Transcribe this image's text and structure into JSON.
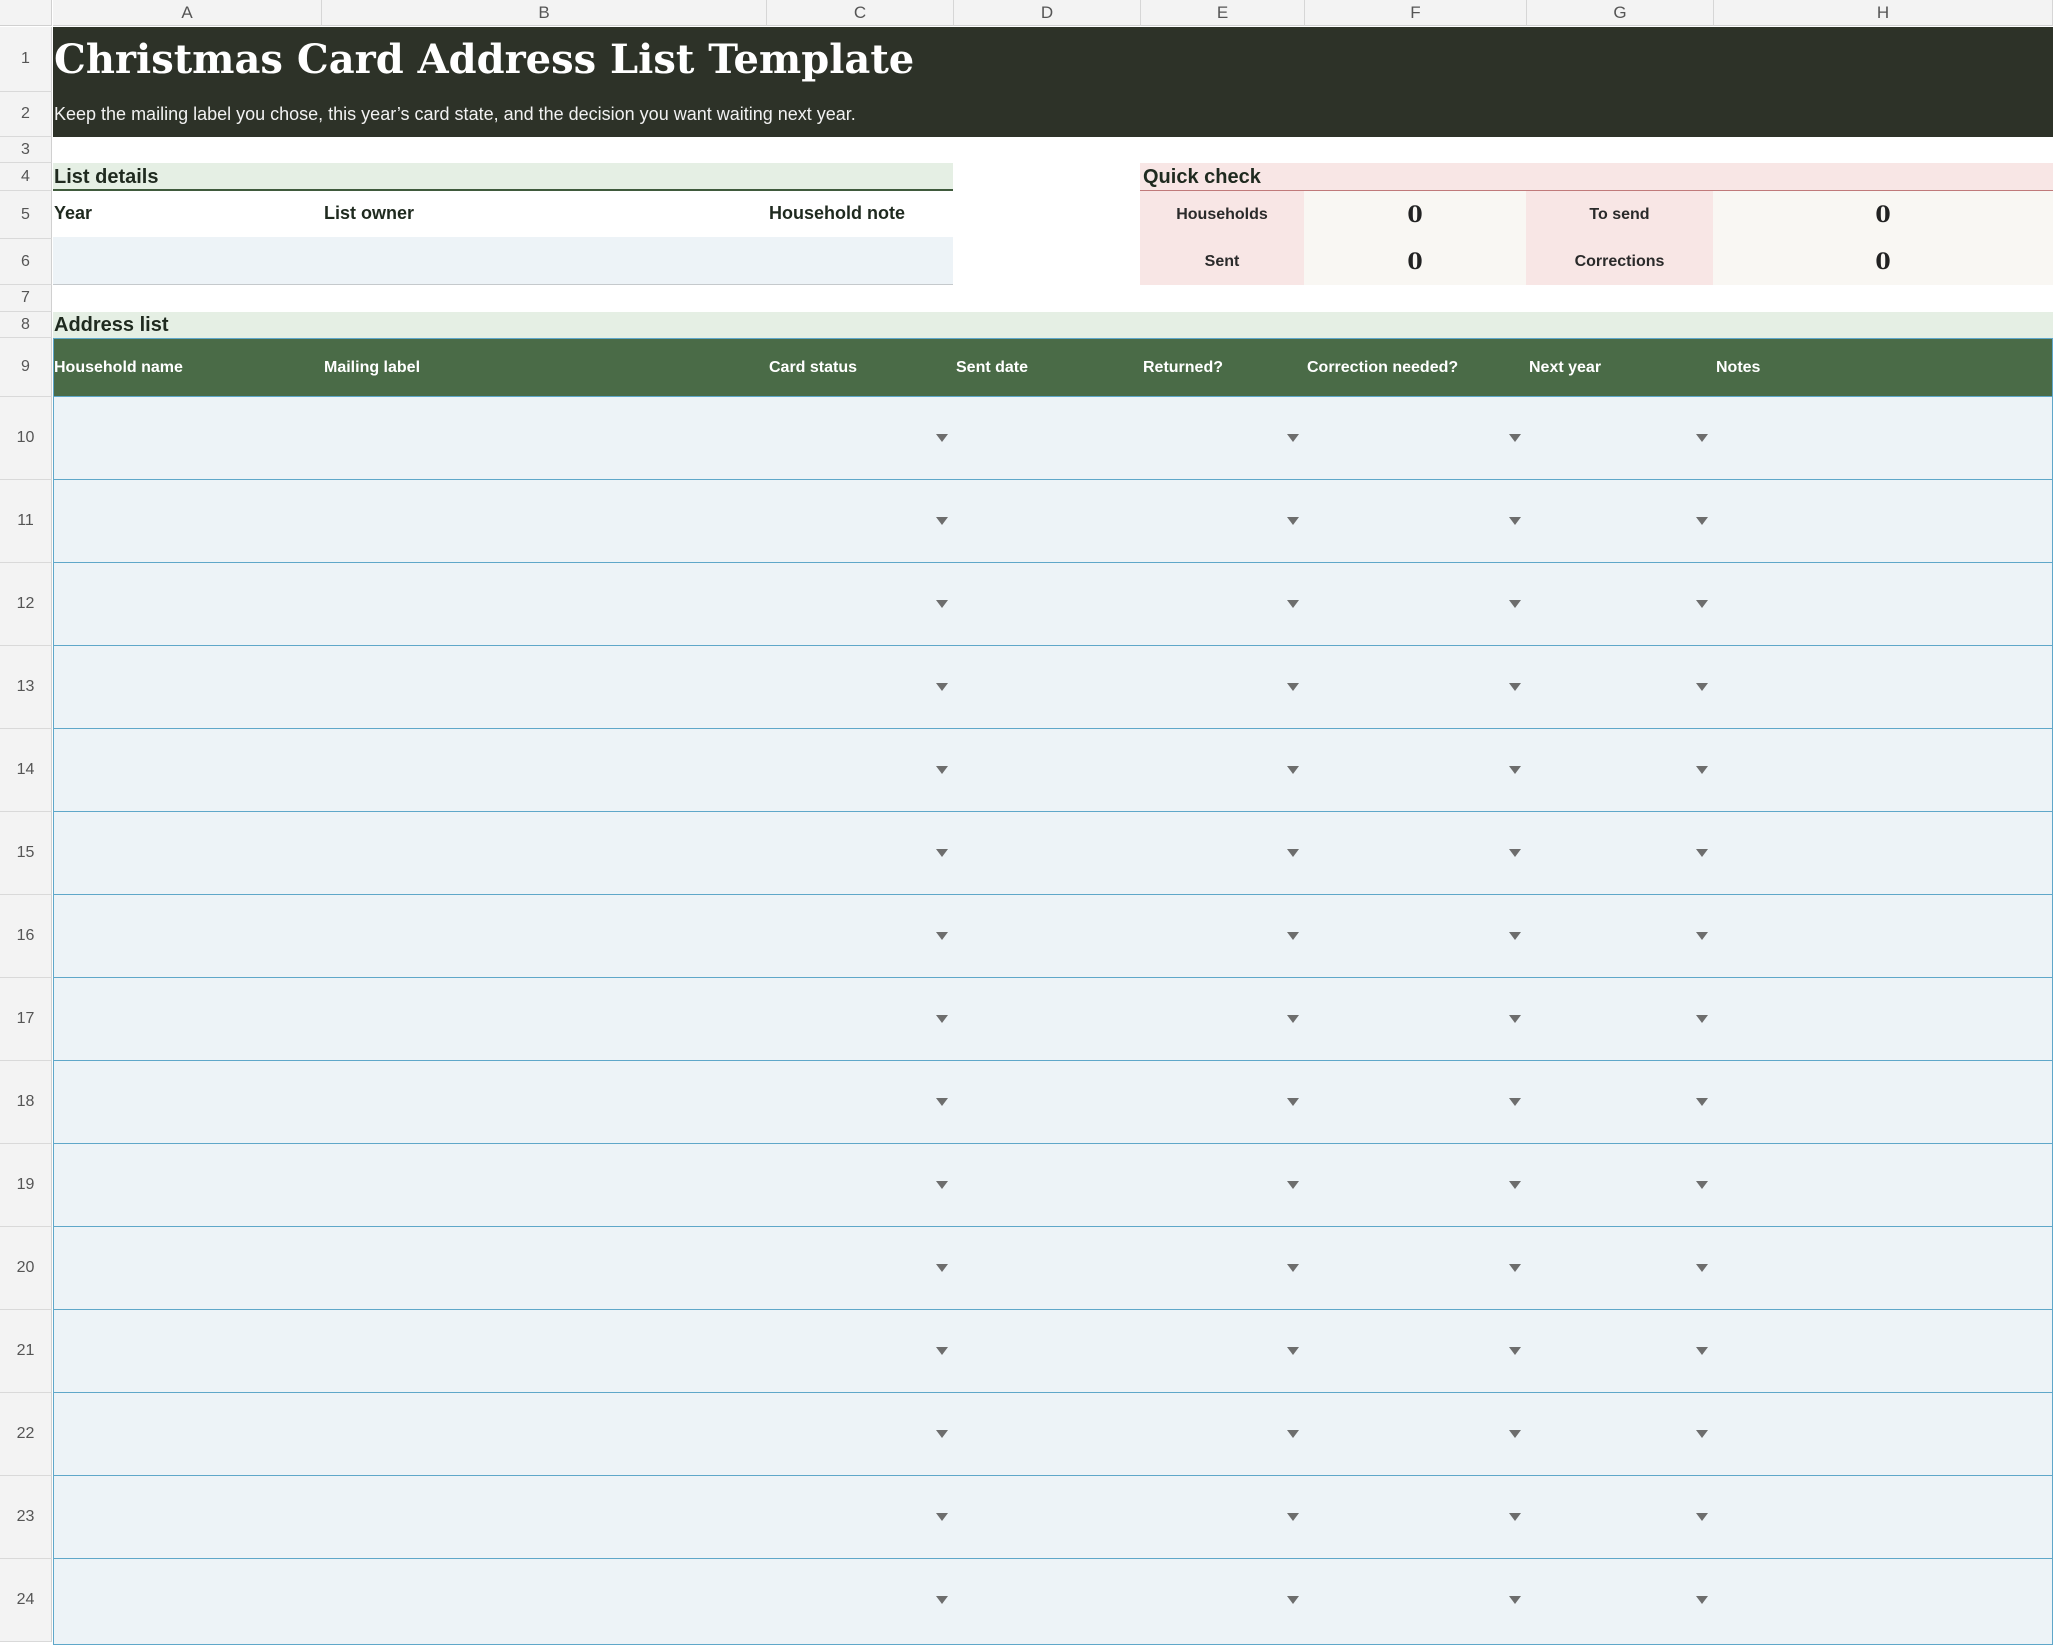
{
  "columns": [
    "A",
    "B",
    "C",
    "D",
    "E",
    "F",
    "G",
    "H"
  ],
  "row_numbers": [
    "1",
    "2",
    "3",
    "4",
    "5",
    "6",
    "7",
    "8",
    "9",
    "10",
    "11",
    "12",
    "13",
    "14",
    "15",
    "16",
    "17",
    "18",
    "19",
    "20",
    "21",
    "22",
    "23",
    "24"
  ],
  "title": "Christmas Card Address List Template",
  "subtitle": "Keep the mailing label you chose, this year’s card state, and the decision you want waiting next year.",
  "list_details": {
    "heading": "List details",
    "fields": [
      "Year",
      "List owner",
      "Household note"
    ]
  },
  "quick_check": {
    "heading": "Quick check",
    "metrics": [
      {
        "label": "Households",
        "value": "0"
      },
      {
        "label": "To send",
        "value": "0"
      },
      {
        "label": "Sent",
        "value": "0"
      },
      {
        "label": "Corrections",
        "value": "0"
      }
    ]
  },
  "address_list": {
    "heading": "Address list",
    "headers": [
      "Household name",
      "Mailing label",
      "Card status",
      "Sent date",
      "Returned?",
      "Correction needed?",
      "Next year",
      "Notes"
    ],
    "dropdown_columns": [
      "Card status",
      "Returned?",
      "Correction needed?",
      "Next year"
    ],
    "row_count": 15
  },
  "colors": {
    "title_band": "#2d3228",
    "table_header": "#4a6b47",
    "section_green": "#e5efe4",
    "section_pink": "#f8e6e5",
    "input_fill": "#edf3f7",
    "row_border": "#5fa7c9"
  }
}
